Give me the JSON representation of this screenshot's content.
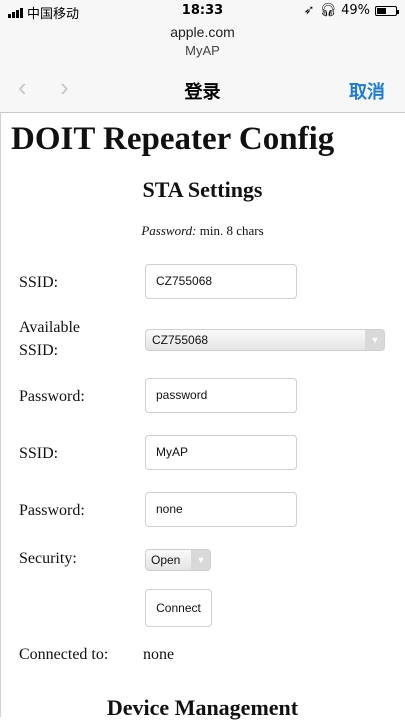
{
  "status_bar": {
    "carrier": "中国移动",
    "time": "18:33",
    "battery_text": "49%",
    "battery_level": 0.49
  },
  "browser": {
    "url": "apple.com",
    "page_name": "MyAP",
    "back_icon": "chevron-left-icon",
    "forward_icon": "chevron-right-icon",
    "nav_title": "登录",
    "cancel_label": "取消",
    "accent_color": "#1a7bdc"
  },
  "page": {
    "title": "DOIT Repeater Config",
    "sta_section": "STA Settings",
    "hint_label": "Password:",
    "hint_text": " min. 8 chars",
    "ssid_label": "SSID:",
    "ssid_value": "CZ755068",
    "available_label_1": "Available",
    "available_label_2": "SSID:",
    "available_selected": "CZ755068",
    "password_label": "Password:",
    "password_value": "password",
    "ap_ssid_label": "SSID:",
    "ap_ssid_value": "MyAP",
    "ap_password_label": "Password:",
    "ap_password_value": "none",
    "security_label": "Security:",
    "security_selected": "Open",
    "connect_label": "Connect",
    "connected_label": "Connected to:",
    "connected_value": "none",
    "device_section": "Device Management"
  }
}
